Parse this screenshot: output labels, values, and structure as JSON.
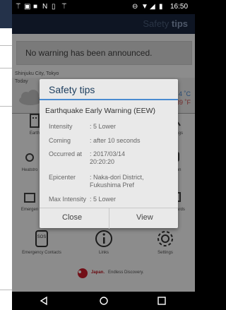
{
  "status_bar": {
    "time": "16:50"
  },
  "app": {
    "title_part1": "Safety",
    "title_part2": "tips",
    "warning": "No warning has been announced.",
    "location": "Shinjuku City, Tokyo",
    "today": "Today",
    "temp_c": "4 ˚C",
    "temp_f": "39 ˚F"
  },
  "grid": {
    "row1": [
      "Earth",
      "",
      "Warnings"
    ],
    "row2": [
      "Heatstro",
      "",
      "ortation"
    ],
    "row3": [
      "Emergen",
      "",
      "ation Cards"
    ],
    "row4": [
      "Emergency Contacts",
      "Links",
      "Settings"
    ]
  },
  "footer": {
    "brand": "Japan.",
    "slogan": "Endless Discovery."
  },
  "dialog": {
    "title": "Safety tips",
    "subtitle": "Earthquake Early Warning (EEW)",
    "rows": [
      {
        "key": "Intensity",
        "value": ": 5 Lower"
      },
      {
        "key": "Coming",
        "value": ": after 10 seconds"
      },
      {
        "key": "Occurred at",
        "value": ": 2017/03/14 20:20:20"
      },
      {
        "key": "Epicenter",
        "value": ": Naka-dori District, Fukushima Pref"
      },
      {
        "key": "Max Intensity",
        "value": ": 5 Lower"
      }
    ],
    "close": "Close",
    "view": "View"
  },
  "colors": {
    "accent": "#4a8bd1",
    "app_bar": "#1b2740"
  },
  "icons": [
    "cast-icon",
    "image-icon",
    "app-icon",
    "nfc-icon",
    "android-icon",
    "minus-circle-icon",
    "wifi-icon",
    "signal-icon",
    "battery-icon",
    "back-icon",
    "home-icon",
    "recents-icon"
  ]
}
